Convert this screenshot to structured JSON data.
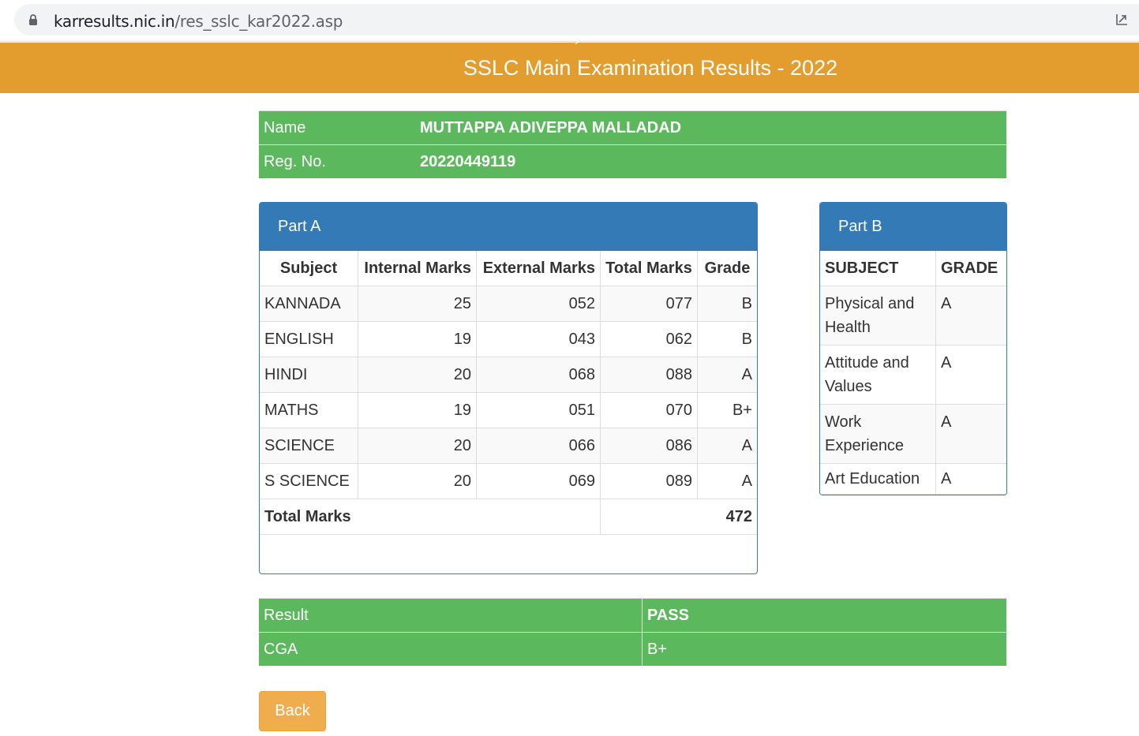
{
  "browser": {
    "url_host": "karresults.nic.in",
    "url_path": "/res_sslc_kar2022.asp"
  },
  "header": {
    "title": "SSLC Main Examination Results - 2022",
    "clipped_text": "y"
  },
  "student": {
    "name_label": "Name",
    "name": "MUTTAPPA ADIVEPPA MALLADAD",
    "reg_label": "Reg. No.",
    "reg_no": "20220449119"
  },
  "part_a": {
    "heading": "Part A",
    "columns": {
      "subject": "Subject",
      "internal": "Internal Marks",
      "external": "External Marks",
      "total": "Total Marks",
      "grade": "Grade"
    },
    "rows": [
      {
        "subject": "KANNADA",
        "internal": "25",
        "external": "052",
        "total": "077",
        "grade": "B"
      },
      {
        "subject": "ENGLISH",
        "internal": "19",
        "external": "043",
        "total": "062",
        "grade": "B"
      },
      {
        "subject": "HINDI",
        "internal": "20",
        "external": "068",
        "total": "088",
        "grade": "A"
      },
      {
        "subject": "MATHS",
        "internal": "19",
        "external": "051",
        "total": "070",
        "grade": "B+"
      },
      {
        "subject": "SCIENCE",
        "internal": "20",
        "external": "066",
        "total": "086",
        "grade": "A"
      },
      {
        "subject": "S SCIENCE",
        "internal": "20",
        "external": "069",
        "total": "089",
        "grade": "A"
      }
    ],
    "total_label": "Total Marks",
    "total_value": "472"
  },
  "part_b": {
    "heading": "Part B",
    "columns": {
      "subject": "SUBJECT",
      "grade": "GRADE"
    },
    "rows": [
      {
        "subject": "Physical and Health",
        "grade": "A"
      },
      {
        "subject": "Attitude and Values",
        "grade": "A"
      },
      {
        "subject": "Work Experience",
        "grade": "A"
      },
      {
        "subject": "Art Education",
        "grade": "A"
      }
    ]
  },
  "result": {
    "result_label": "Result",
    "result_value": "PASS",
    "cga_label": "CGA",
    "cga_value": "B+"
  },
  "actions": {
    "back_label": "Back"
  },
  "colors": {
    "header_orange": "#e39d2e",
    "success_green": "#5cb85c",
    "panel_blue": "#337ab7",
    "button_orange": "#f0ad4e"
  },
  "icons": {
    "lock": "lock-icon",
    "share": "share-icon"
  }
}
